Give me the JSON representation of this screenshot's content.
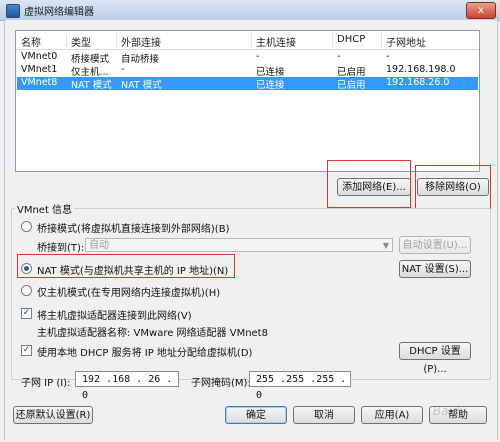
{
  "window": {
    "title": "虚拟网络编辑器",
    "close_label": "x"
  },
  "table": {
    "columns": [
      "名称",
      "类型",
      "外部连接",
      "主机连接",
      "DHCP",
      "子网地址"
    ],
    "rows": [
      [
        "VMnet0",
        "桥接模式",
        "自动桥接",
        "-",
        "-",
        "-"
      ],
      [
        "VMnet1",
        "仅主机...",
        "-",
        "已连接",
        "已启用",
        "192.168.198.0"
      ],
      [
        "VMnet8",
        "NAT 模式",
        "NAT 模式",
        "已连接",
        "已启用",
        "192.168.26.0"
      ]
    ]
  },
  "buttons": {
    "add_network": "添加网络(E)...",
    "remove_network": "移除网络(O)",
    "auto_settings": "自动设置(U)...",
    "nat_settings": "NAT 设置(S)...",
    "dhcp_settings": "DHCP 设置(P)...",
    "restore_defaults": "还原默认设置(R)",
    "ok": "确定",
    "cancel": "取消",
    "apply": "应用(A)",
    "help": "帮助"
  },
  "vmnet_info": {
    "title": "VMnet 信息",
    "bridged_label": "桥接模式(将虚拟机直接连接到外部网络)(B)",
    "bridged_to_label": "桥接到(T):",
    "bridged_to_value": "自动",
    "nat_label": "NAT 模式(与虚拟机共享主机的 IP 地址)(N)",
    "host_only_label": "仅主机模式(在专用网络内连接虚拟机)(H)",
    "connect_adapter_label": "将主机虚拟适配器连接到此网络(V)",
    "adapter_name_label": "主机虚拟适配器名称: VMware 网络适配器 VMnet8",
    "dhcp_label": "使用本地 DHCP 服务将 IP 地址分配给虚拟机(D)"
  },
  "subnet": {
    "ip_label": "子网 IP (I):",
    "ip_value": "192 .168 . 26 . 0",
    "mask_label": "子网掩码(M):",
    "mask_value": "255 .255 .255 . 0"
  },
  "watermark": "Baidu"
}
